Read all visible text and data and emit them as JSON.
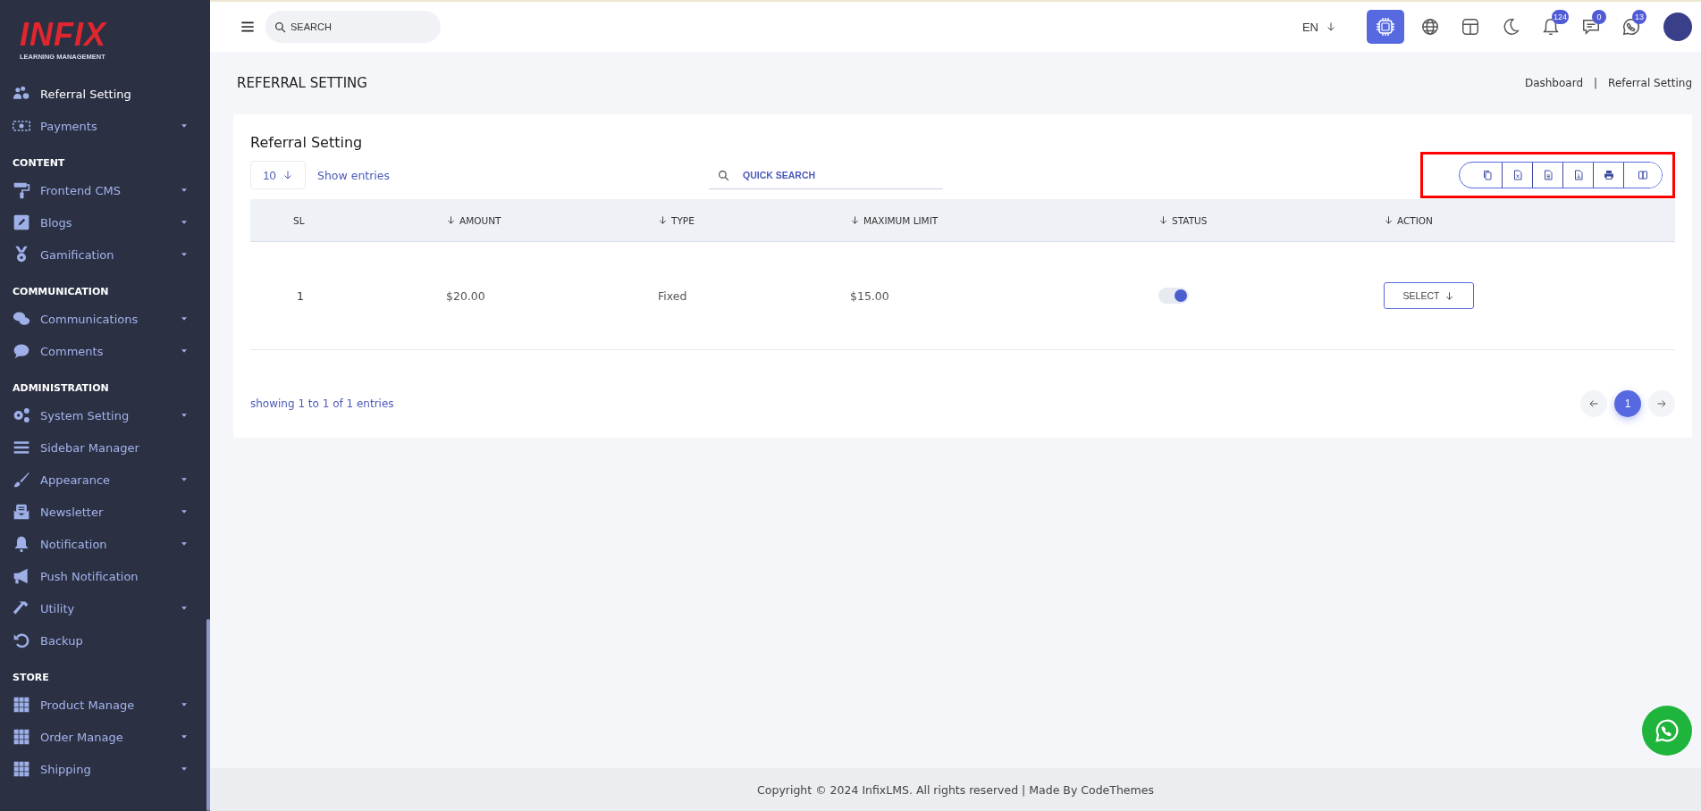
{
  "brand": {
    "name": "INFIX",
    "tagline": "LEARNING MANAGEMENT"
  },
  "sidebar": {
    "items": [
      {
        "label": "Referral Setting",
        "selected": true,
        "has_submenu": false
      },
      {
        "label": "Payments",
        "selected": false,
        "has_submenu": true
      }
    ],
    "sections": [
      {
        "heading": "CONTENT",
        "items": [
          {
            "label": "Frontend CMS",
            "selected": false,
            "has_submenu": true
          },
          {
            "label": "Blogs",
            "selected": false,
            "has_submenu": true
          },
          {
            "label": "Gamification",
            "selected": false,
            "has_submenu": true
          }
        ]
      },
      {
        "heading": "COMMUNICATION",
        "items": [
          {
            "label": "Communications",
            "selected": false,
            "has_submenu": true
          },
          {
            "label": "Comments",
            "selected": false,
            "has_submenu": true
          }
        ]
      },
      {
        "heading": "ADMINISTRATION",
        "items": [
          {
            "label": "System Setting",
            "selected": false,
            "has_submenu": true
          },
          {
            "label": "Sidebar Manager",
            "selected": false,
            "has_submenu": false
          },
          {
            "label": "Appearance",
            "selected": false,
            "has_submenu": true
          },
          {
            "label": "Newsletter",
            "selected": false,
            "has_submenu": true
          },
          {
            "label": "Notification",
            "selected": false,
            "has_submenu": true
          },
          {
            "label": "Push Notification",
            "selected": false,
            "has_submenu": false
          },
          {
            "label": "Utility",
            "selected": false,
            "has_submenu": true
          },
          {
            "label": "Backup",
            "selected": false,
            "has_submenu": false
          }
        ]
      },
      {
        "heading": "STORE",
        "items": [
          {
            "label": "Product Manage",
            "selected": false,
            "has_submenu": true
          },
          {
            "label": "Order Manage",
            "selected": false,
            "has_submenu": true
          },
          {
            "label": "Shipping",
            "selected": false,
            "has_submenu": true
          }
        ]
      }
    ]
  },
  "topbar": {
    "search": {
      "placeholder": "SEARCH"
    },
    "language": "EN",
    "badges": [
      "124",
      "0",
      "13"
    ]
  },
  "page": {
    "title": "REFERRAL SETTING",
    "breadcrumb": [
      "Dashboard",
      "Referral Setting"
    ],
    "breadcrumb_separator": "|"
  },
  "card": {
    "title": "Referral Setting",
    "page_size": "10",
    "page_size_label": "Show entries",
    "search": {
      "placeholder": "QUICK SEARCH"
    },
    "export_toolbar_highlighted": true,
    "table": {
      "columns": [
        {
          "label": "SL",
          "sortable": false
        },
        {
          "label": "AMOUNT",
          "sortable": true
        },
        {
          "label": "TYPE",
          "sortable": true
        },
        {
          "label": "MAXIMUM LIMIT",
          "sortable": true
        },
        {
          "label": "STATUS",
          "sortable": true
        },
        {
          "label": "ACTION",
          "sortable": true
        }
      ],
      "rows": [
        {
          "sl": "1",
          "amount": "$20.00",
          "type": "Fixed",
          "maximum_limit": "$15.00",
          "status_on": true,
          "action": "SELECT"
        }
      ]
    },
    "info": "showing 1 to 1 of 1 entries",
    "pages": [
      {
        "label": "1",
        "selected": true
      }
    ]
  },
  "footer": "Copyright © 2024 InfixLMS. All rights reserved | Made By CodeThemes"
}
